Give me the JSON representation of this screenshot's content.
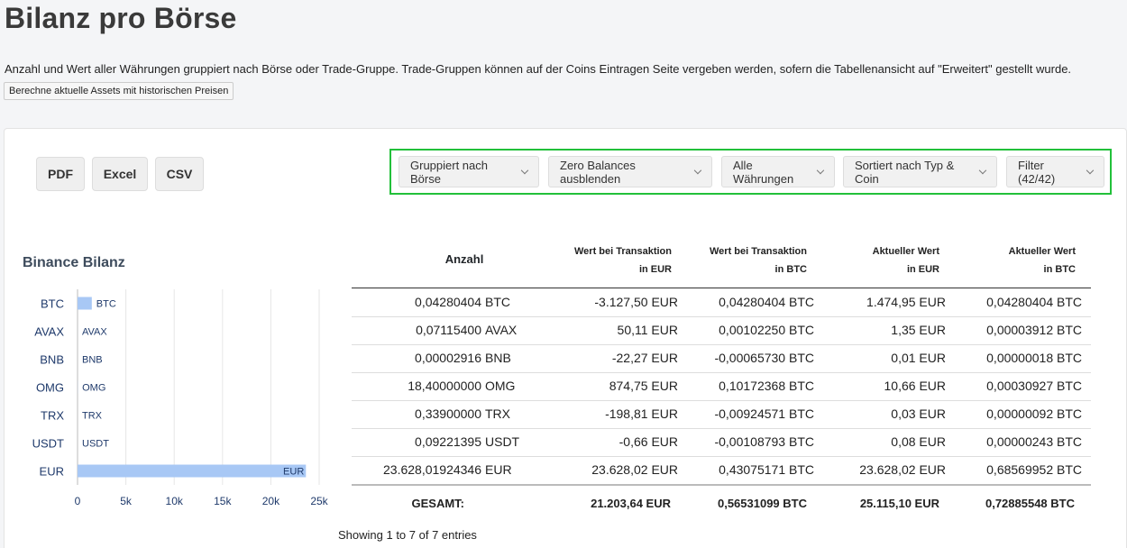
{
  "page": {
    "title": "Bilanz pro Börse",
    "description": "Anzahl und Wert aller Währungen gruppiert nach Börse oder Trade-Gruppe. Trade-Gruppen können auf der Coins Eintragen Seite vergeben werden, sofern die Tabellenansicht auf \"Erweitert\" gestellt wurde.",
    "calc_button": "Berechne aktuelle Assets mit historischen Preisen"
  },
  "export": {
    "pdf": "PDF",
    "excel": "Excel",
    "csv": "CSV"
  },
  "filters": {
    "group": "Gruppiert nach Börse",
    "zero": "Zero Balances ausblenden",
    "currencies": "Alle Währungen",
    "sort": "Sortiert nach Typ & Coin",
    "filter": "Filter (42/42)"
  },
  "chart": {
    "title": "Binance Bilanz"
  },
  "chart_data": {
    "type": "bar",
    "orientation": "horizontal",
    "categories": [
      "BTC",
      "AVAX",
      "BNB",
      "OMG",
      "TRX",
      "USDT",
      "EUR"
    ],
    "values": [
      1474.95,
      1.35,
      0.01,
      10.66,
      0.03,
      0.08,
      23628.02
    ],
    "bar_labels": [
      "BTC",
      "AVAX",
      "BNB",
      "OMG",
      "TRX",
      "USDT",
      "EUR"
    ],
    "xlim": [
      0,
      25000
    ],
    "x_ticks": [
      "0",
      "5k",
      "10k",
      "15k",
      "20k",
      "25k"
    ],
    "grid": true,
    "color": "#a8c8f5"
  },
  "table": {
    "headers": {
      "anzahl": "Anzahl",
      "wert_eur_1": "Wert bei Transaktion",
      "wert_eur_2": "in EUR",
      "wert_btc_1": "Wert bei Transaktion",
      "wert_btc_2": "in BTC",
      "akt_eur_1": "Aktueller Wert",
      "akt_eur_2": "in EUR",
      "akt_btc_1": "Aktueller Wert",
      "akt_btc_2": "in BTC"
    },
    "rows": [
      {
        "amount": "0,04280404",
        "coin": "BTC",
        "tx_eur": "-3.127,50 EUR",
        "tx_btc": "0,04280404 BTC",
        "cur_eur": "1.474,95 EUR",
        "cur_btc": "0,04280404 BTC"
      },
      {
        "amount": "0,07115400",
        "coin": "AVAX",
        "tx_eur": "50,11 EUR",
        "tx_btc": "0,00102250 BTC",
        "cur_eur": "1,35 EUR",
        "cur_btc": "0,00003912 BTC"
      },
      {
        "amount": "0,00002916",
        "coin": "BNB",
        "tx_eur": "-22,27 EUR",
        "tx_btc": "-0,00065730 BTC",
        "cur_eur": "0,01 EUR",
        "cur_btc": "0,00000018 BTC"
      },
      {
        "amount": "18,40000000",
        "coin": "OMG",
        "tx_eur": "874,75 EUR",
        "tx_btc": "0,10172368 BTC",
        "cur_eur": "10,66 EUR",
        "cur_btc": "0,00030927 BTC"
      },
      {
        "amount": "0,33900000",
        "coin": "TRX",
        "tx_eur": "-198,81 EUR",
        "tx_btc": "-0,00924571 BTC",
        "cur_eur": "0,03 EUR",
        "cur_btc": "0,00000092 BTC"
      },
      {
        "amount": "0,09221395",
        "coin": "USDT",
        "tx_eur": "-0,66 EUR",
        "tx_btc": "-0,00108793 BTC",
        "cur_eur": "0,08 EUR",
        "cur_btc": "0,00000243 BTC"
      },
      {
        "amount": "23.628,01924346",
        "coin": "EUR",
        "tx_eur": "23.628,02 EUR",
        "tx_btc": "0,43075171 BTC",
        "cur_eur": "23.628,02 EUR",
        "cur_btc": "0,68569952 BTC"
      }
    ],
    "total": {
      "label": "GESAMT:",
      "tx_eur": "21.203,64 EUR",
      "tx_btc": "0,56531099 BTC",
      "cur_eur": "25.115,10 EUR",
      "cur_btc": "0,72885548 BTC"
    },
    "info": "Showing 1 to 7 of 7 entries"
  }
}
